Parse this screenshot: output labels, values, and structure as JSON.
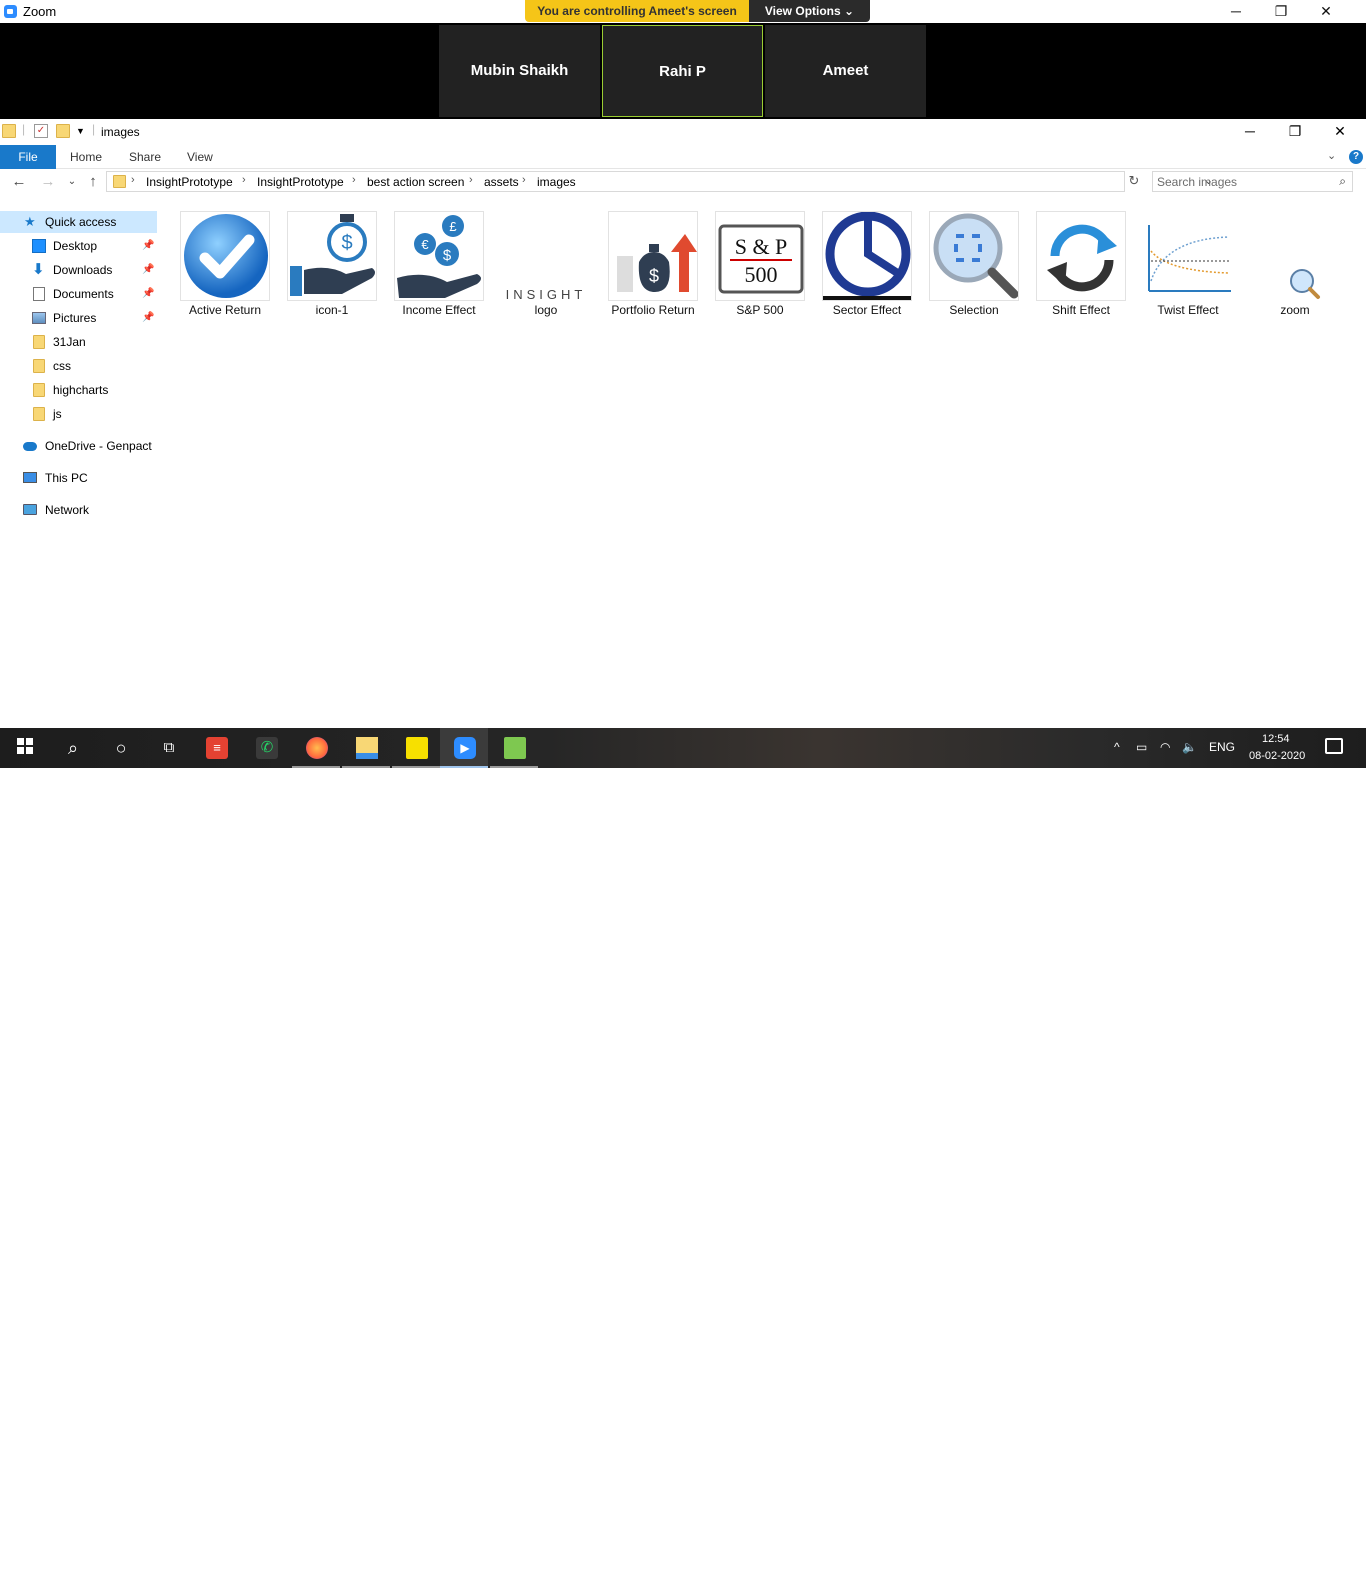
{
  "zoom": {
    "title": "Zoom",
    "banner": "You are controlling Ameet's screen",
    "view_options": "View Options",
    "participants": [
      "Mubin Shaikh",
      "Rahi P",
      "Ameet"
    ]
  },
  "explorer": {
    "window_title": "images",
    "ribbon_tabs": [
      "File",
      "Home",
      "Share",
      "View"
    ],
    "breadcrumb": [
      "InsightPrototype",
      "InsightPrototype",
      "best action screen",
      "assets",
      "images"
    ],
    "search_placeholder": "Search images",
    "sidebar": {
      "quick_access": "Quick access",
      "pinned": [
        "Desktop",
        "Downloads",
        "Documents",
        "Pictures"
      ],
      "folders": [
        "31Jan",
        "css",
        "highcharts",
        "js"
      ],
      "onedrive": "OneDrive - Genpact",
      "this_pc": "This PC",
      "network": "Network"
    },
    "files": [
      {
        "label": "Active Return",
        "icon": "checkmark-circle-icon"
      },
      {
        "label": "icon-1",
        "icon": "dollar-hand-icon"
      },
      {
        "label": "Income Effect",
        "icon": "currency-hand-icon"
      },
      {
        "label": "logo",
        "icon": "insight-logo",
        "logo_text": "INSIGHT"
      },
      {
        "label": "Portfolio Return",
        "icon": "money-bag-arrow-icon"
      },
      {
        "label": "S&P 500",
        "icon": "sp500-icon",
        "text_top": "S & P",
        "text_bottom": "500"
      },
      {
        "label": "Sector Effect",
        "icon": "pie-chart-icon"
      },
      {
        "label": "Selection",
        "icon": "magnifier-icon"
      },
      {
        "label": "Shift Effect",
        "icon": "refresh-arrows-icon"
      },
      {
        "label": "Twist Effect",
        "icon": "line-chart-icon"
      },
      {
        "label": "zoom",
        "icon": "zoom-magnifier-icon"
      }
    ]
  },
  "taskbar": {
    "language": "ENG",
    "time": "12:54",
    "date": "08-02-2020"
  },
  "colors": {
    "accent": "#1979ca",
    "banner": "#f5c518",
    "folder": "#f8d775"
  }
}
